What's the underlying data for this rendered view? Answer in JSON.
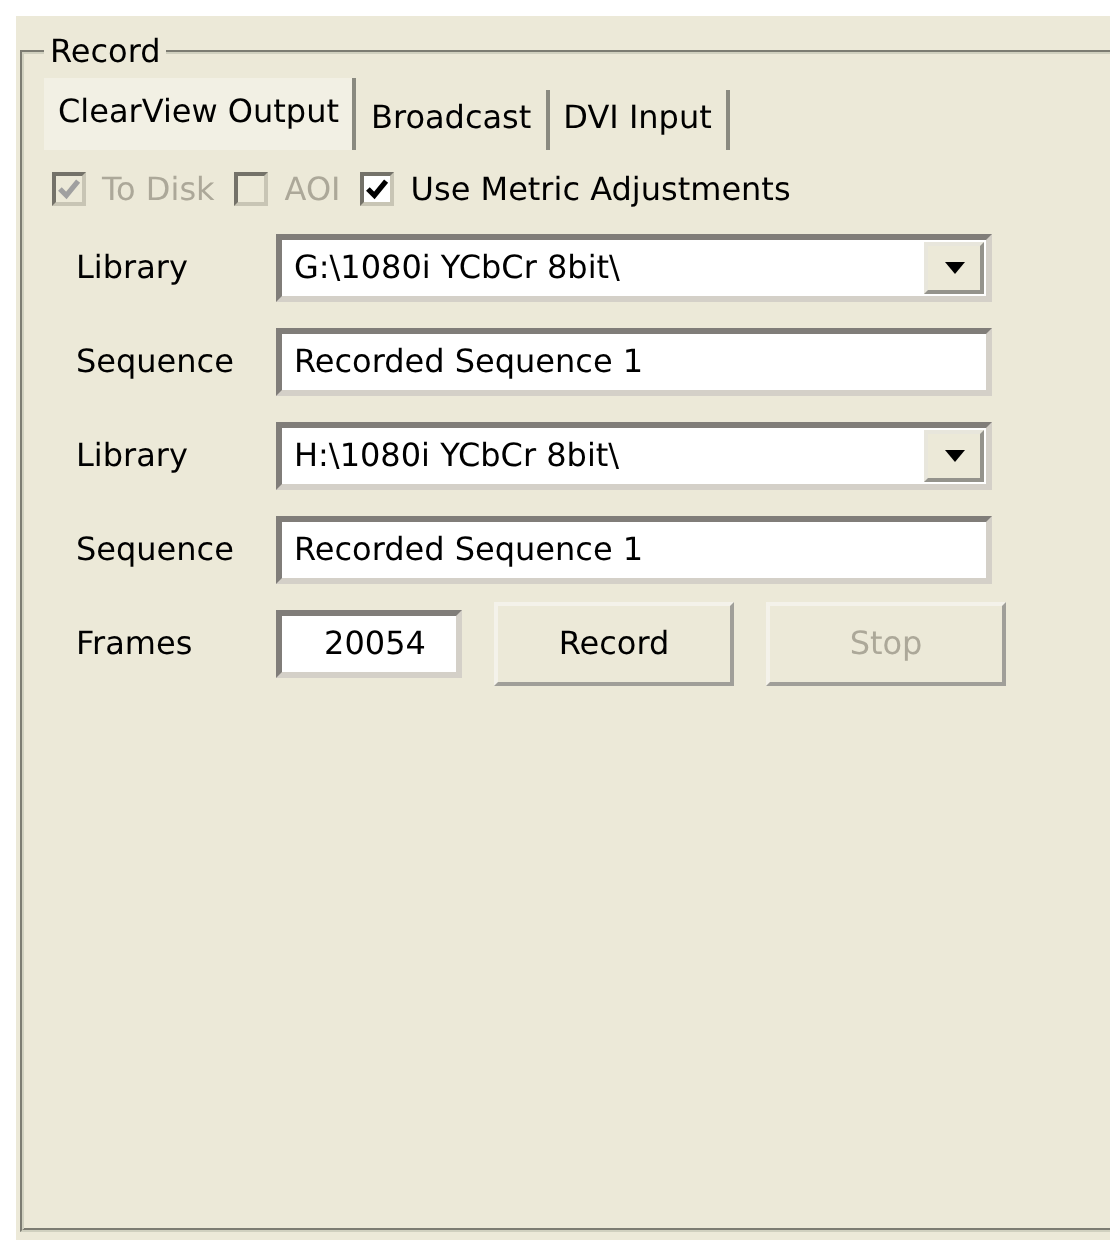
{
  "group": {
    "title": "Record"
  },
  "tabs": [
    {
      "label": "ClearView Output",
      "selected": true
    },
    {
      "label": "Broadcast",
      "selected": false
    },
    {
      "label": "DVI Input",
      "selected": false
    }
  ],
  "options": [
    {
      "label": "To Disk",
      "checked": true,
      "disabled": true
    },
    {
      "label": "AOI",
      "checked": false,
      "disabled": true
    },
    {
      "label": "Use Metric Adjustments",
      "checked": true,
      "disabled": false
    }
  ],
  "rows": [
    {
      "kind": "combo",
      "label": "Library",
      "value": "G:\\1080i YCbCr 8bit\\"
    },
    {
      "kind": "text",
      "label": "Sequence",
      "value": "Recorded Sequence 1"
    },
    {
      "kind": "combo",
      "label": "Library",
      "value": "H:\\1080i YCbCr 8bit\\"
    },
    {
      "kind": "text",
      "label": "Sequence",
      "value": "Recorded Sequence 1"
    }
  ],
  "frames": {
    "label": "Frames",
    "value": "20054"
  },
  "buttons": [
    {
      "label": "Record",
      "disabled": false
    },
    {
      "label": "Stop",
      "disabled": true
    }
  ]
}
